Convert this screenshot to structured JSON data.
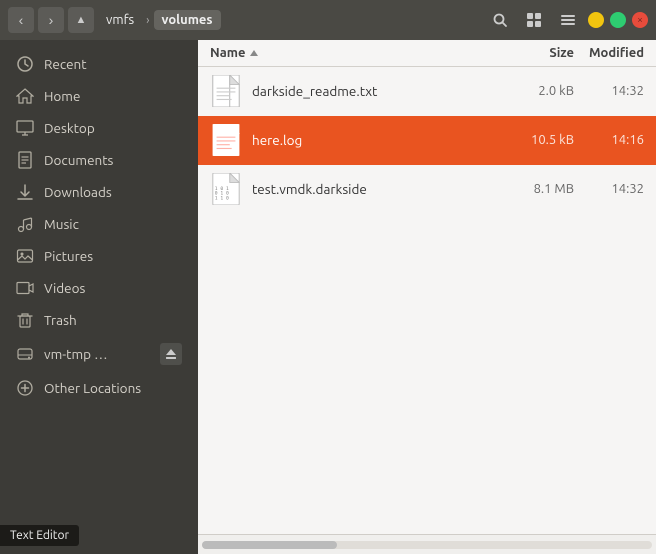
{
  "titlebar": {
    "btn_close": "×",
    "btn_minimize": "−",
    "btn_maximize": "+",
    "nav_back": "‹",
    "nav_forward": "›",
    "nav_up": "↑",
    "breadcrumb": [
      {
        "label": "vmfs",
        "active": false
      },
      {
        "label": "volumes",
        "active": true
      }
    ],
    "search_icon": "🔍",
    "view_grid_icon": "⊞",
    "menu_icon": "≡"
  },
  "sidebar": {
    "items": [
      {
        "id": "recent",
        "label": "Recent",
        "icon": "🕐"
      },
      {
        "id": "home",
        "label": "Home",
        "icon": "🏠"
      },
      {
        "id": "desktop",
        "label": "Desktop",
        "icon": "📁"
      },
      {
        "id": "documents",
        "label": "Documents",
        "icon": "📄"
      },
      {
        "id": "downloads",
        "label": "Downloads",
        "icon": "⬇"
      },
      {
        "id": "music",
        "label": "Music",
        "icon": "🎵"
      },
      {
        "id": "pictures",
        "label": "Pictures",
        "icon": "📷"
      },
      {
        "id": "videos",
        "label": "Videos",
        "icon": "🎬"
      },
      {
        "id": "trash",
        "label": "Trash",
        "icon": "🗑"
      },
      {
        "id": "vmtmp",
        "label": "vm-tmp …",
        "icon": "💾",
        "eject": true
      },
      {
        "id": "other",
        "label": "Other Locations",
        "icon": "+"
      }
    ]
  },
  "columns": {
    "name": "Name",
    "size": "Size",
    "modified": "Modified"
  },
  "files": [
    {
      "name": "darkside_readme.txt",
      "type": "txt",
      "size": "2.0 kB",
      "modified": "14:32",
      "selected": false
    },
    {
      "name": "here.log",
      "type": "log",
      "size": "10.5 kB",
      "modified": "14:16",
      "selected": true
    },
    {
      "name": "test.vmdk.darkside",
      "type": "vmdk",
      "size": "8.1 MB",
      "modified": "14:32",
      "selected": false
    }
  ],
  "taskbar": {
    "text_editor": "Text Editor"
  }
}
